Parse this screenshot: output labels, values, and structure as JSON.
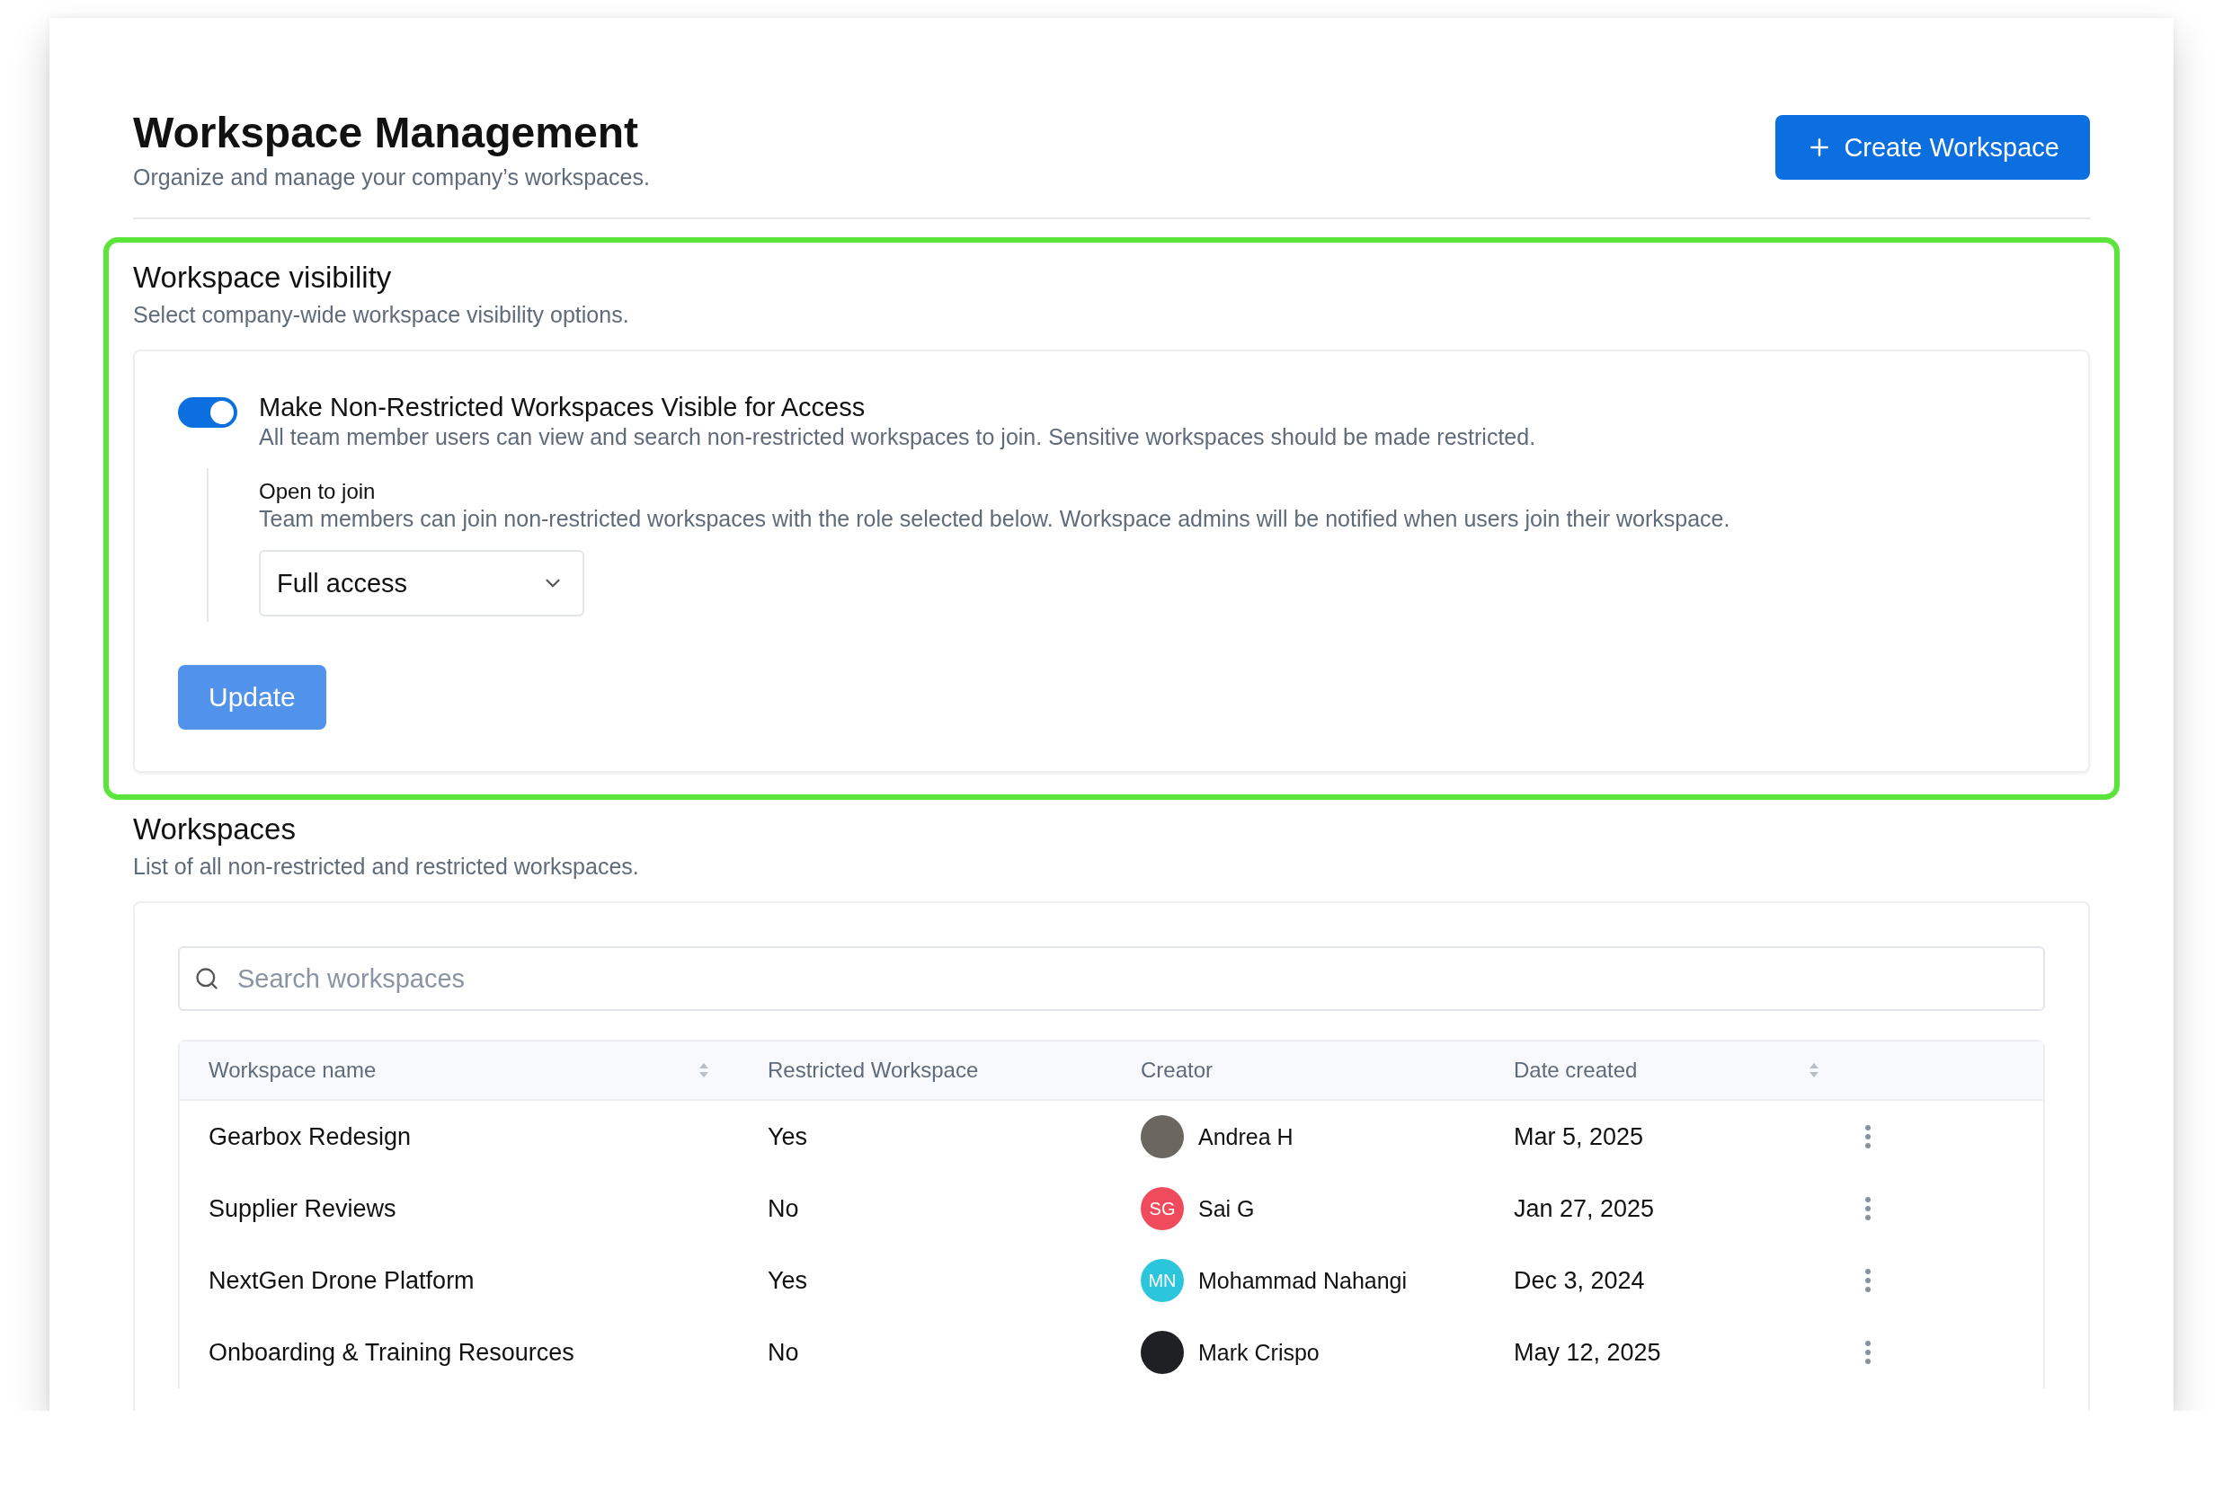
{
  "header": {
    "title": "Workspace Management",
    "subtitle": "Organize and manage your company’s workspaces.",
    "create_button": "Create Workspace"
  },
  "visibility": {
    "highlighted": true,
    "title": "Workspace visibility",
    "subtitle": "Select company-wide workspace visibility options.",
    "toggle": {
      "label": "Make Non-Restricted Workspaces Visible for Access",
      "description": "All team member users can view and search non-restricted workspaces to join. Sensitive workspaces should be made restricted.",
      "on": true
    },
    "open_to_join": {
      "label": "Open to join",
      "description": "Team members can join non-restricted workspaces with the role selected below. Workspace admins will be notified when users join their workspace.",
      "value": "Full access"
    },
    "update_button": {
      "label": "Update",
      "disabled": true
    }
  },
  "workspaces": {
    "title": "Workspaces",
    "subtitle": "List of all non-restricted and restricted workspaces.",
    "search": {
      "placeholder": "Search workspaces"
    },
    "columns": [
      {
        "label": "Workspace name",
        "sortable": true
      },
      {
        "label": "Restricted Workspace",
        "sortable": false
      },
      {
        "label": "Creator",
        "sortable": false
      },
      {
        "label": "Date created",
        "sortable": true
      }
    ],
    "rows": [
      {
        "name": "Gearbox Redesign",
        "restricted": "Yes",
        "creator": {
          "name": "Andrea H",
          "kind": "photo"
        },
        "date": "Mar 5, 2025"
      },
      {
        "name": "Supplier Reviews",
        "restricted": "No",
        "creator": {
          "name": "Sai G",
          "kind": "initials",
          "initials": "SG",
          "color": "#f04b5d"
        },
        "date": "Jan 27, 2025"
      },
      {
        "name": "NextGen Drone Platform",
        "restricted": "Yes",
        "creator": {
          "name": "Mohammad Nahangi",
          "kind": "initials",
          "initials": "MN",
          "color": "#2cc6dc"
        },
        "date": "Dec 3, 2024"
      },
      {
        "name": "Onboarding & Training Resources",
        "restricted": "No",
        "creator": {
          "name": "Mark Crispo",
          "kind": "plain"
        },
        "date": "May 12, 2025"
      }
    ]
  }
}
